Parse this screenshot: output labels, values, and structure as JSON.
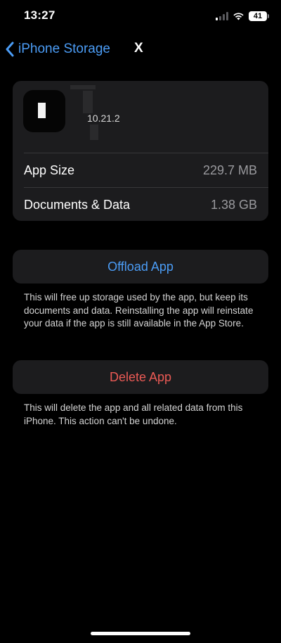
{
  "status_bar": {
    "time": "13:27",
    "battery_level": "41",
    "icons": [
      "cellular-signal-icon",
      "wifi-icon",
      "battery-icon"
    ]
  },
  "nav": {
    "back_label": "iPhone Storage",
    "close_label": "X",
    "back_icon": "chevron-left-icon"
  },
  "app": {
    "version": "10.21.2",
    "icon": "app-icon"
  },
  "storage_rows": [
    {
      "label": "App Size",
      "value": "229.7 MB"
    },
    {
      "label": "Documents & Data",
      "value": "1.38 GB"
    }
  ],
  "actions": {
    "offload_label": "Offload App",
    "offload_note": "This will free up storage used by the app, but keep its documents and data. Reinstalling the app will reinstate your data if the app is still available in the App Store.",
    "delete_label": "Delete App",
    "delete_note": "This will delete the app and all related data from this iPhone. This action can't be undone."
  },
  "colors": {
    "background": "#000000",
    "card": "#1c1c1e",
    "link_blue": "#4b9cf5",
    "destructive_red": "#eb5a55",
    "secondary_text": "#9a9a9e"
  }
}
